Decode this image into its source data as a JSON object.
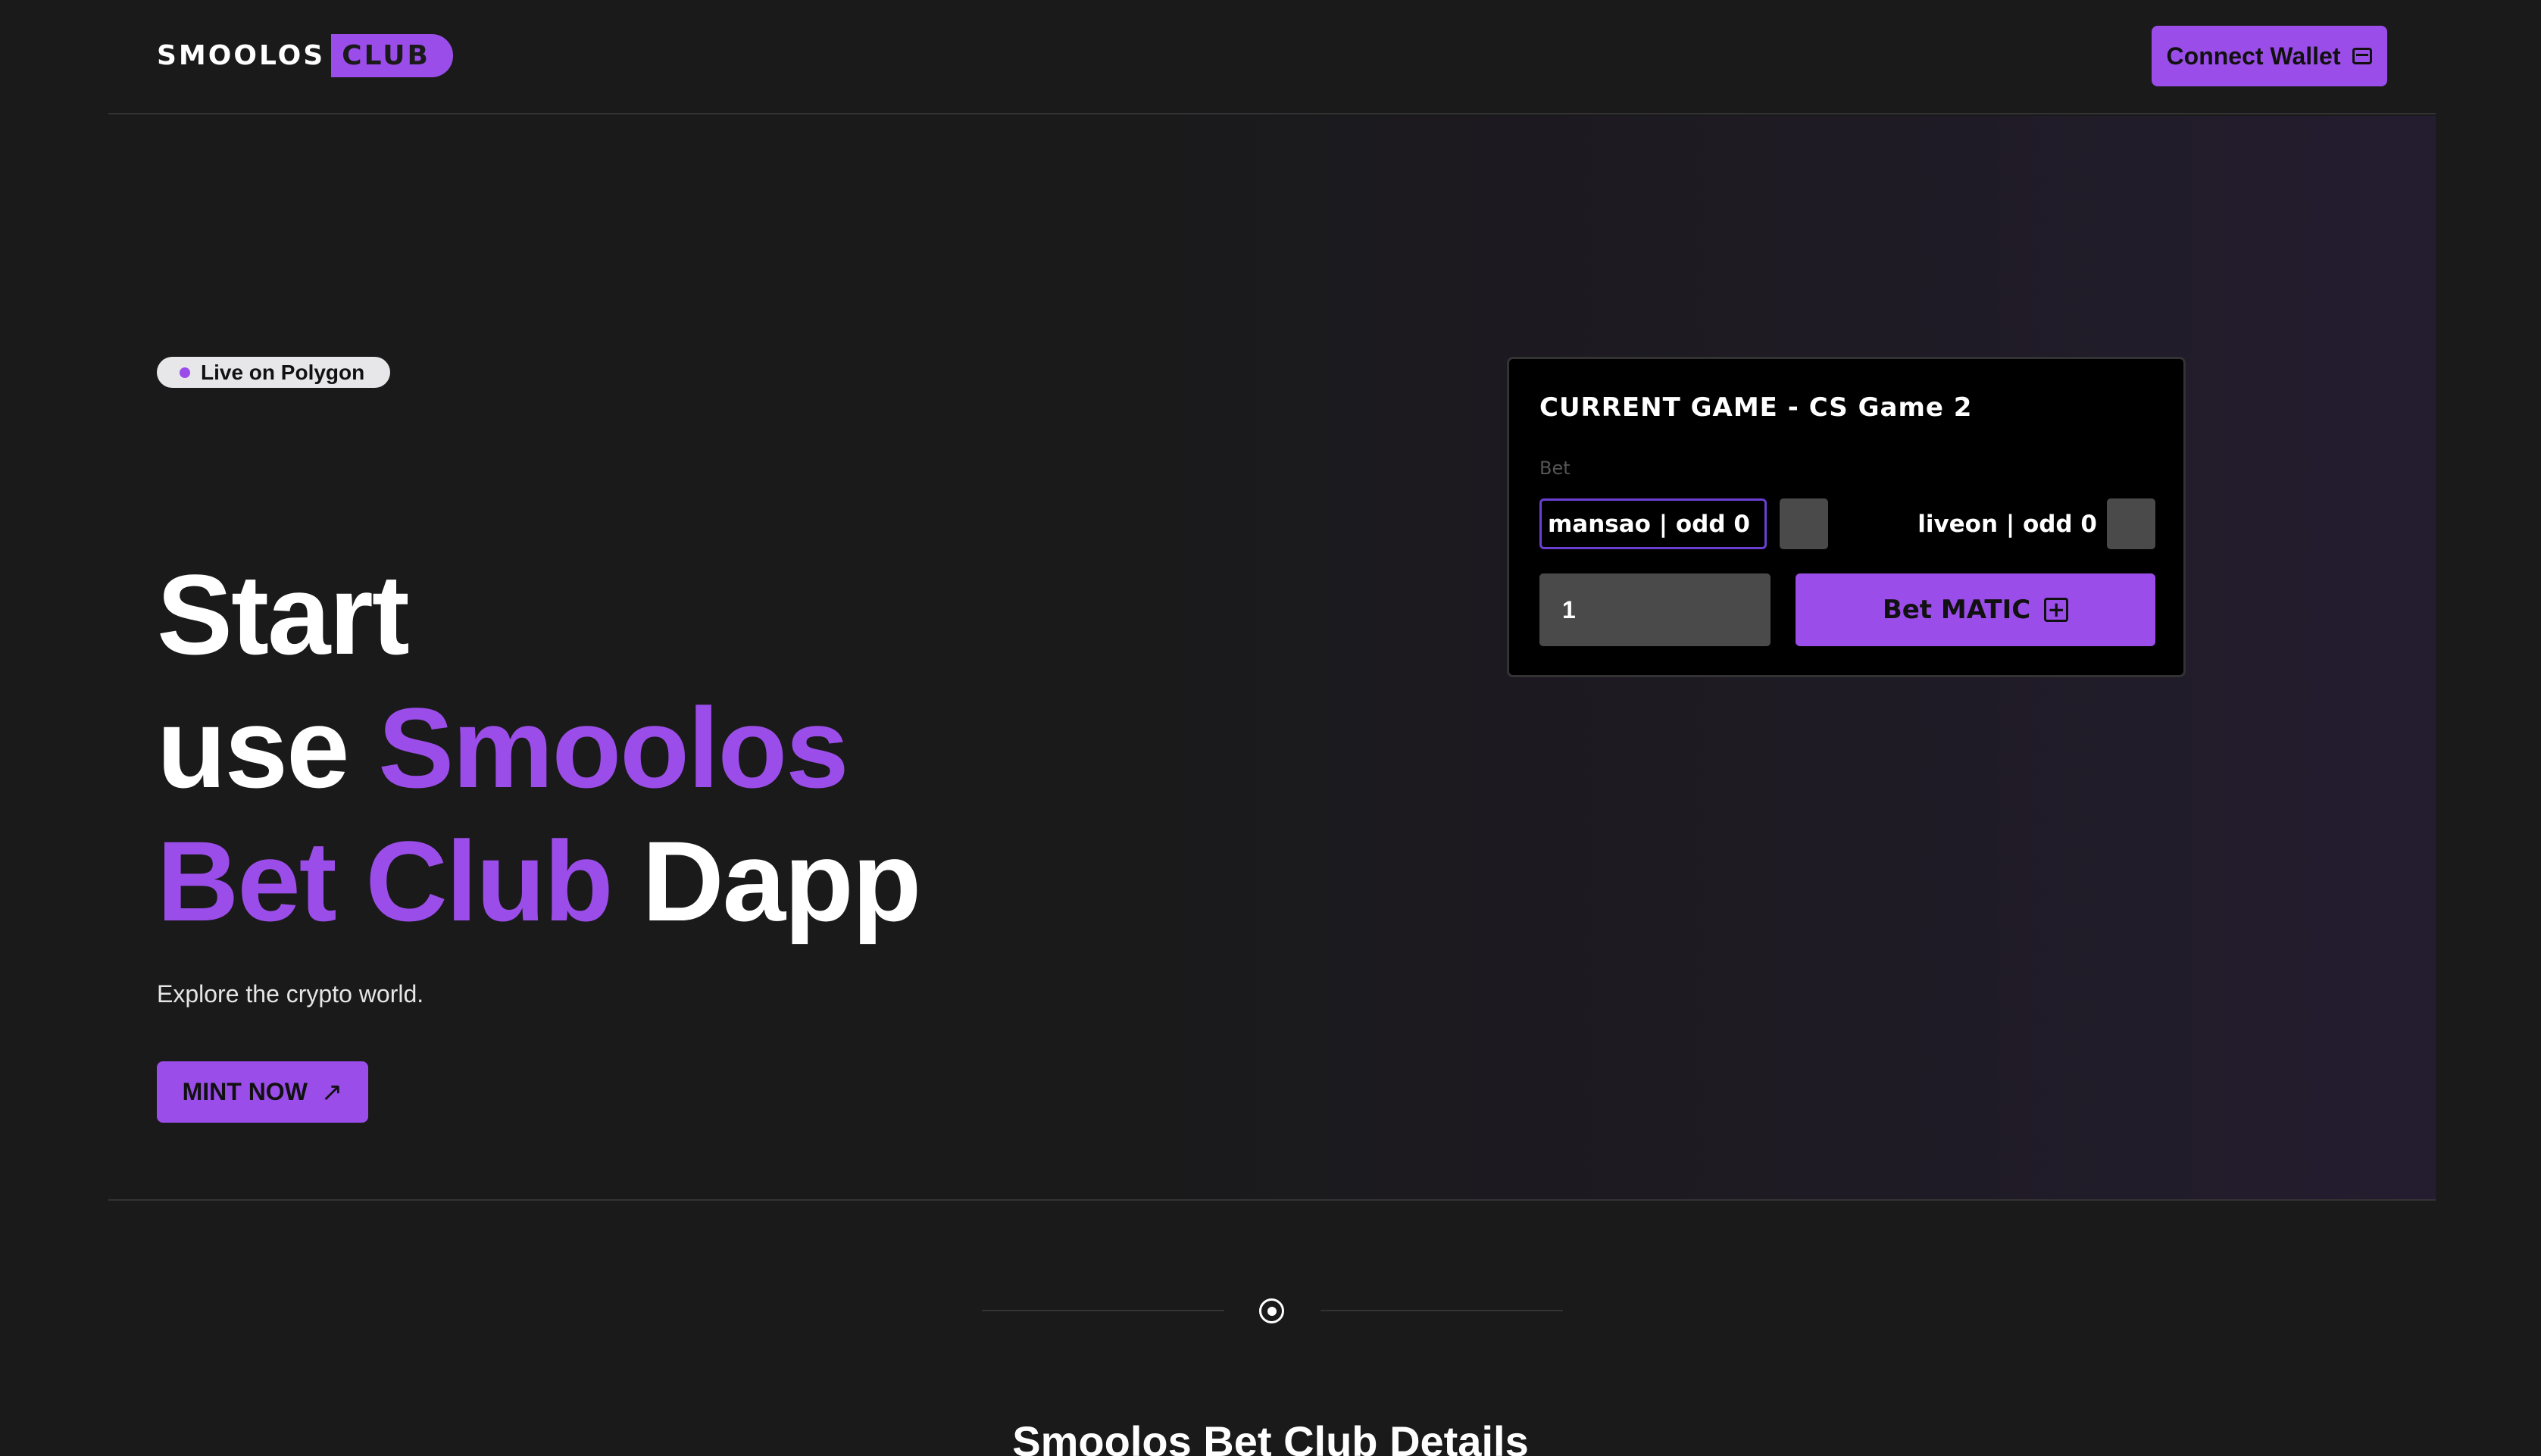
{
  "header": {
    "logo_main": "SMOOLOS",
    "logo_accent": "CLUB",
    "connect_label": "Connect Wallet",
    "connect_icon": "wallet-icon"
  },
  "hero": {
    "badge": "Live on Polygon",
    "headline": {
      "line1": "Start",
      "line2_plain": "use",
      "line2_accent": "Smoolos",
      "line3_accent": "Bet Club",
      "line3_plain": "Dapp"
    },
    "subtitle": "Explore the crypto world.",
    "mint_label": "MINT NOW",
    "mint_icon": "arrow-up-right-icon"
  },
  "game_card": {
    "title": "CURRENT GAME - CS Game 2",
    "bet_label": "Bet",
    "option_a": "mansao | odd 0",
    "option_b": "liveon | odd 0",
    "amount_value": "1",
    "bet_button": "Bet MATIC",
    "bet_icon": "plus-square-icon"
  },
  "details": {
    "title": "Smoolos Bet Club Details"
  },
  "colors": {
    "accent": "#9b4de9",
    "background": "#1a1a1b",
    "card_background": "#000000"
  }
}
